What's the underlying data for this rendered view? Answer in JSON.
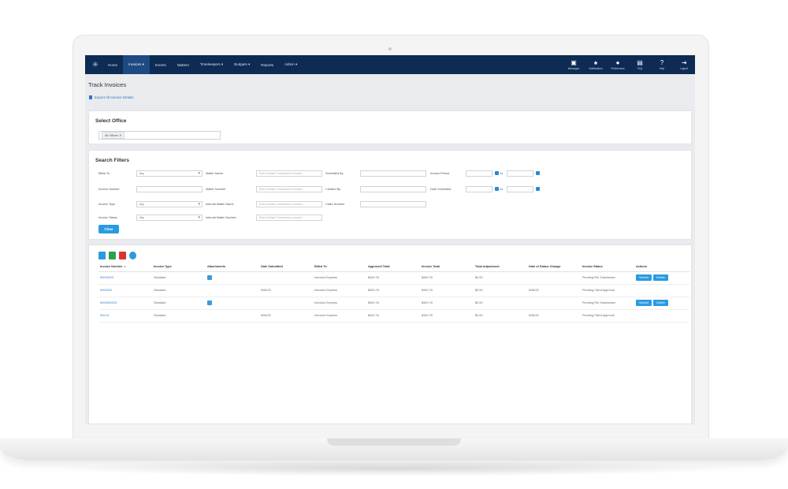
{
  "nav": {
    "items": [
      "Home",
      "Invoices ▾",
      "Events",
      "Matters",
      "Timekeepers ▾",
      "Budgets ▾",
      "Reports",
      "Admin ▾"
    ],
    "right_items": [
      {
        "label": "Messages",
        "icon": "inbox-icon"
      },
      {
        "label": "Notifications",
        "icon": "bell-icon"
      },
      {
        "label": "Preferences",
        "icon": "user-gear-icon"
      },
      {
        "label": "FAQ",
        "icon": "document-icon"
      },
      {
        "label": "Help",
        "icon": "help-icon"
      },
      {
        "label": "Logout",
        "icon": "logout-icon"
      }
    ]
  },
  "page": {
    "title": "Track Invoices",
    "export_label": "Export All Invoice Details"
  },
  "select_office": {
    "title": "Select Office",
    "tag": "All Offices ✕"
  },
  "filters": {
    "title": "Search Filters",
    "billed_to": {
      "label": "Billed To",
      "value": "Any"
    },
    "invoice_number": {
      "label": "Invoice Number"
    },
    "invoice_type": {
      "label": "Invoice Type",
      "value": "Any"
    },
    "invoice_status": {
      "label": "Invoice Status",
      "value": "Any"
    },
    "matter_name": {
      "label": "Matter Name",
      "placeholder": "Enter at least 2 characters to search"
    },
    "matter_number": {
      "label": "Matter Number",
      "placeholder": "Enter at least 2 characters to search"
    },
    "internal_matter_name": {
      "label": "Internal Matter Name",
      "placeholder": "Enter at least 2 characters to search"
    },
    "internal_matter_number": {
      "label": "Internal Matter Number",
      "placeholder": "Enter at least 2 characters to search"
    },
    "submitted_by": {
      "label": "Submitted By"
    },
    "created_by": {
      "label": "Created By"
    },
    "claim_number": {
      "label": "Claim Number"
    },
    "invoice_period": {
      "label": "Invoice Period",
      "to": "to"
    },
    "date_submitted": {
      "label": "Date Submitted",
      "to": "to"
    },
    "clear_label": "Clear"
  },
  "table": {
    "headers": [
      "Invoice Number",
      "Invoice Type",
      "Attachments",
      "Date Submitted",
      "Billed To",
      "Approved Total",
      "Invoice Total",
      "Total Adjustment",
      "Date of Status Change",
      "Invoice Status",
      "Actions"
    ],
    "rows": [
      {
        "number": "INV00023",
        "type": "Standard",
        "attachment": true,
        "date_submitted": "",
        "billed_to": "eInvoice Express",
        "approved": "$400.78",
        "total": "$400.78",
        "adjustment": "$0.00",
        "status_change": "",
        "status": "Pending File Submission",
        "actions": [
          "Submit",
          "Delete"
        ]
      },
      {
        "number": "INV0023",
        "type": "Standard",
        "attachment": false,
        "date_submitted": "5/06/23",
        "billed_to": "eInvoice Express",
        "approved": "$400.78",
        "total": "$400.78",
        "adjustment": "$0.00",
        "status_change": "5/06/23",
        "status": "Pending Client Approval",
        "actions": []
      },
      {
        "number": "INV0000023",
        "type": "Standard",
        "attachment": true,
        "date_submitted": "",
        "billed_to": "eInvoice Express",
        "approved": "$400.78",
        "total": "$400.78",
        "adjustment": "$0.00",
        "status_change": "",
        "status": "Pending File Submission",
        "actions": [
          "Submit",
          "Delete"
        ]
      },
      {
        "number": "INV-01",
        "type": "Standard",
        "attachment": false,
        "date_submitted": "5/06/23",
        "billed_to": "eInvoice Express",
        "approved": "$400.78",
        "total": "$400.78",
        "adjustment": "$0.00",
        "status_change": "5/06/23",
        "status": "Pending Client Approval",
        "actions": []
      }
    ]
  }
}
